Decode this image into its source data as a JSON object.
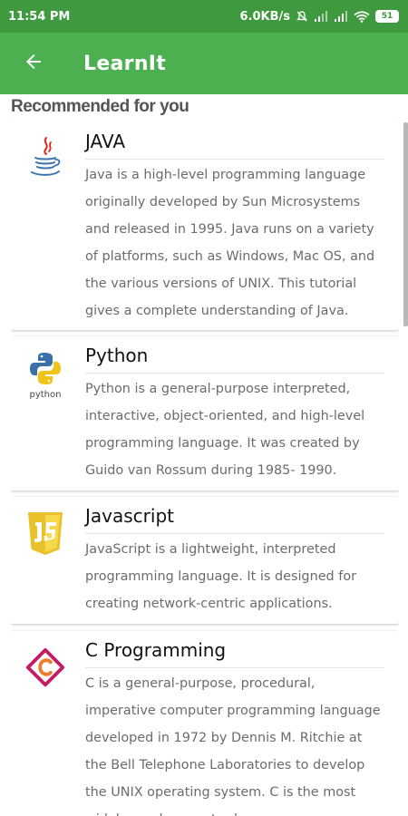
{
  "status_bar": {
    "time": "11:54 PM",
    "network_speed": "6.0KB/s",
    "battery_level": "51",
    "icons": [
      "mute-icon",
      "signal-icon",
      "signal-icon",
      "wifi-icon",
      "battery-icon"
    ]
  },
  "app_bar": {
    "back_icon": "arrow-left-icon",
    "title": "LearnIt"
  },
  "section": {
    "title": "Recommended for you"
  },
  "colors": {
    "status_bar": "#3f9a3f",
    "app_bar": "#4caf50",
    "header_text": "#555555",
    "title_text": "#111111",
    "desc_text": "#6b6b6b"
  },
  "courses": [
    {
      "icon": "java-logo-icon",
      "title": "JAVA",
      "description": "Java is a high-level programming language originally developed by Sun Microsystems and released in 1995. Java runs on a variety of platforms, such as Windows, Mac OS, and the various versions of UNIX. This tutorial gives a complete understanding of Java."
    },
    {
      "icon": "python-logo-icon",
      "logo_text": "python",
      "title": "Python",
      "description": "Python is a general-purpose interpreted, interactive, object-oriented, and high-level programming language. It was created by Guido van Rossum during 1985- 1990."
    },
    {
      "icon": "javascript-logo-icon",
      "title": "Javascript",
      "description": "JavaScript is a lightweight, interpreted programming language. It is designed for creating network-centric applications."
    },
    {
      "icon": "c-logo-icon",
      "title": "C Programming",
      "description": "C is a general-purpose, procedural, imperative computer programming language developed in 1972 by Dennis M. Ritchie at the Bell Telephone Laboratories to develop the UNIX operating system. C is the most widely used computer language."
    }
  ]
}
